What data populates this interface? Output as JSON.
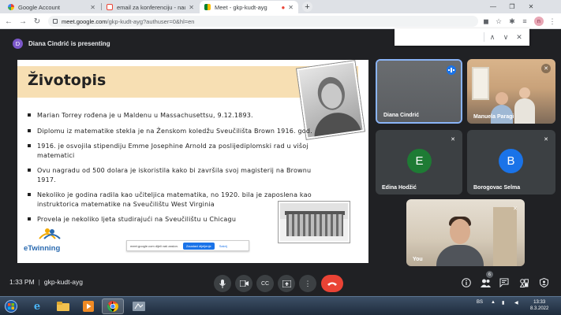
{
  "browser": {
    "tabs": [
      {
        "title": "Google Account",
        "favicon": "google-g-icon",
        "active": false
      },
      {
        "title": "email za konferenciju - nadamiru",
        "favicon": "gmail-icon",
        "active": false
      },
      {
        "title": "Meet - gkp-kudt-ayg",
        "favicon": "meet-icon",
        "active": true
      }
    ],
    "url_host": "meet.google.com",
    "url_path": "/gkp-kudt-ayg?authuser=0&hl=en",
    "profile_initial": "n"
  },
  "findbar": {
    "prev": "∧",
    "next": "∨",
    "close": "✕"
  },
  "banner": {
    "avatar_initial": "D",
    "text": "Diana Cindrić is presenting"
  },
  "slide": {
    "title": "Životopis",
    "bullets": [
      "Marian Torrey rođena je u Maldenu u Massachusettsu, 9.12.1893.",
      "Diplomu iz matematike stekla je na Ženskom koledžu Sveučilišta Brown 1916. god.",
      "1916. je osvojila stipendiju Emme Josephine Arnold za poslijediplomski rad u višoj matematici",
      "Ovu nagradu od 500 dolara je iskoristila  kako bi završila svoj magisterij na Brownu 1917.",
      "Nekoliko je godina radila kao učiteljica matematika, no 1920. bila je zaposlena kao instruktorica matematike na Sveučilištu West Virginia",
      "Provela je nekoliko ljeta studirajući na Sveučilištu u Chicagu"
    ],
    "logo_text": "eTwinning",
    "share_pill": {
      "text": "meet.google.com dijeli vaš zaslon.",
      "stop": "Zaustavi dijeljenje",
      "hide": "Sakrij"
    }
  },
  "participants": [
    {
      "name": "Diana Cindrić",
      "speaking": true
    },
    {
      "name": "Manuela Paragi",
      "muted": true
    },
    {
      "name": "Edina Hodžić",
      "initial": "E",
      "avatar_color": "#1e7b34",
      "muted": true
    },
    {
      "name": "Borogovac Selma",
      "initial": "B",
      "avatar_color": "#1a73e8",
      "muted": true
    },
    {
      "name": "You",
      "muted": true
    }
  ],
  "bottombar": {
    "time": "1:33 PM",
    "meeting_code": "gkp-kudt-ayg",
    "people_count": "6",
    "controls": [
      "mic-icon",
      "camera-icon",
      "captions-icon",
      "present-icon",
      "more-icon",
      "end-call-icon"
    ],
    "right_controls": [
      "info-icon",
      "people-icon",
      "chat-icon",
      "activities-icon",
      "host-controls-icon"
    ]
  },
  "taskbar": {
    "language": "BS",
    "time": "13:33",
    "date": "8.3.2022"
  },
  "colors": {
    "meet_bg": "#202124",
    "end_call": "#ea4335",
    "slide_band": "#f7dfb3"
  }
}
